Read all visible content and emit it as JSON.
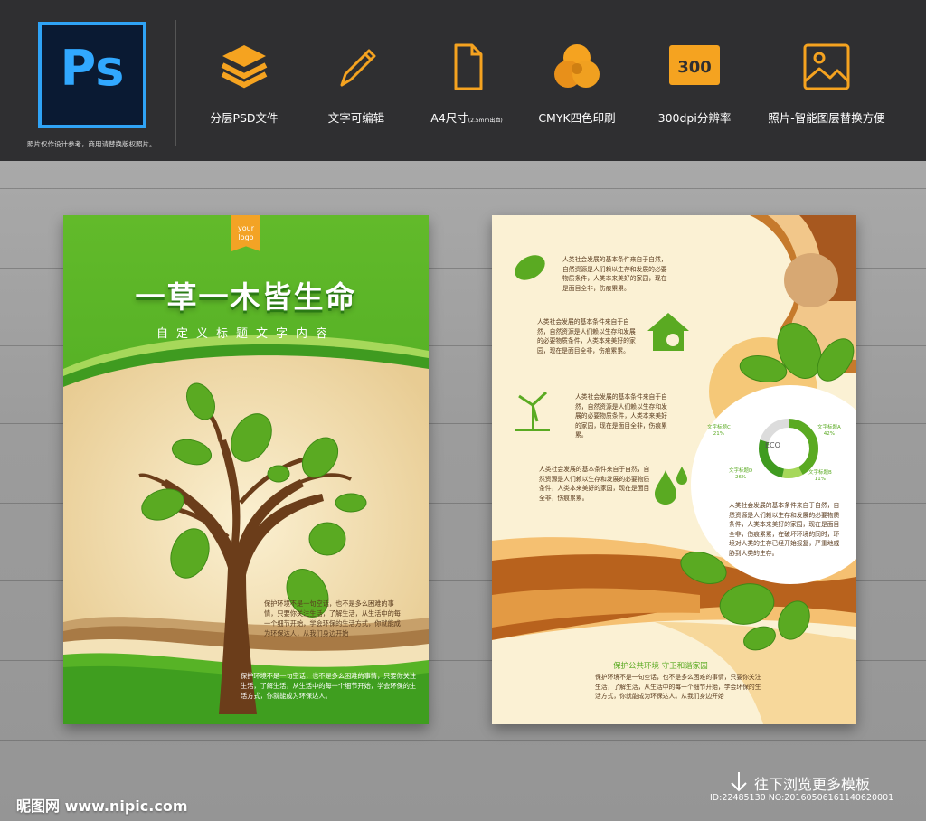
{
  "header": {
    "ps_logo_text": "Ps",
    "note": "照片仅作设计参考，商用请替换版权照片。",
    "features": [
      {
        "icon": "layers-icon",
        "label": "分层PSD文件"
      },
      {
        "icon": "pencil-icon",
        "label": "文字可编辑"
      },
      {
        "icon": "page-icon",
        "label": "A4尺寸",
        "label_small": "(2.5mm出血)"
      },
      {
        "icon": "cmyk-circles-icon",
        "label": "CMYK四色印刷"
      },
      {
        "icon": "dpi-badge-icon",
        "badge": "300",
        "label": "300dpi分辨率"
      },
      {
        "icon": "photo-icon",
        "label": "照片-智能图层替换方便"
      }
    ]
  },
  "poster_front": {
    "logo": "your\nlogo",
    "title": "一草一木皆生命",
    "subtitle": "自定义标题文字内容",
    "paragraph_1": "保护环境不是一句空话，也不是多么困难的事情，只要你关注生活，了解生活，从生活中的每一个细节开始，学会环保的生活方式，你就能成为环保达人，从我们身边开始",
    "paragraph_2": "保护环境不是一句空话，也不是多么困难的事情，只要你关注生活，了解生活，从生活中的每一个细节开始，学会环保的生活方式，你就能成为环保达人。"
  },
  "poster_back": {
    "text_1": "人类社会发展的基本条件来自于自然，自然资源是人们赖以生存和发展的必要物质条件，人类本来美好的家园，现在是面目全非，伤痕累累。",
    "text_2": "人类社会发展的基本条件来自于自然，自然资源是人们赖以生存和发展的必要物质条件，人类本来美好的家园，现在是面目全非，伤痕累累。",
    "text_3": "人类社会发展的基本条件来自于自然，自然资源是人们赖以生存和发展的必要物质条件，人类本来美好的家园，现在是面目全非，伤痕累累。",
    "text_4": "人类社会发展的基本条件来自于自然，自然资源是人们赖以生存和发展的必要物质条件，人类本来美好的家园，现在是面目全非，伤痕累累。",
    "text_5": "人类社会发展的基本条件来自于自然，自然资源是人们赖以生存和发展的必要物质条件，人类本来美好的家园，现在是面目全非，伤痕累累，在破坏环境的同时，环境对人类的生存已经开始报复，严重地威胁到人类的生存。",
    "eco": "ECO",
    "donut_labels": [
      {
        "name": "文字标题C",
        "value": "21%"
      },
      {
        "name": "文字标题A",
        "value": "42%"
      },
      {
        "name": "文字标题D",
        "value": "26%"
      },
      {
        "name": "文字标题B",
        "value": "11%"
      }
    ],
    "slogan": "保护公共环境  守卫和谐家园",
    "bottom_text": "保护环境不是一句空话，也不是多么困难的事情，只要你关注生活，了解生活，从生活中的每一个细节开始，学会环保的生活方式，你就能成为环保达人。从我们身边开始"
  },
  "footer": {
    "site": "昵图网 www.nipic.com",
    "browse": "往下浏览更多模板",
    "id_line": "ID:22485130 NO:20160506161140620001"
  },
  "colors": {
    "top_bar": "#2f2f31",
    "icon_orange": "#f5a320",
    "ps_blue": "#31a8ff",
    "leaf_green": "#5aaa22",
    "trunk_brown": "#6b3d1a",
    "cream": "#fbf1d4"
  }
}
